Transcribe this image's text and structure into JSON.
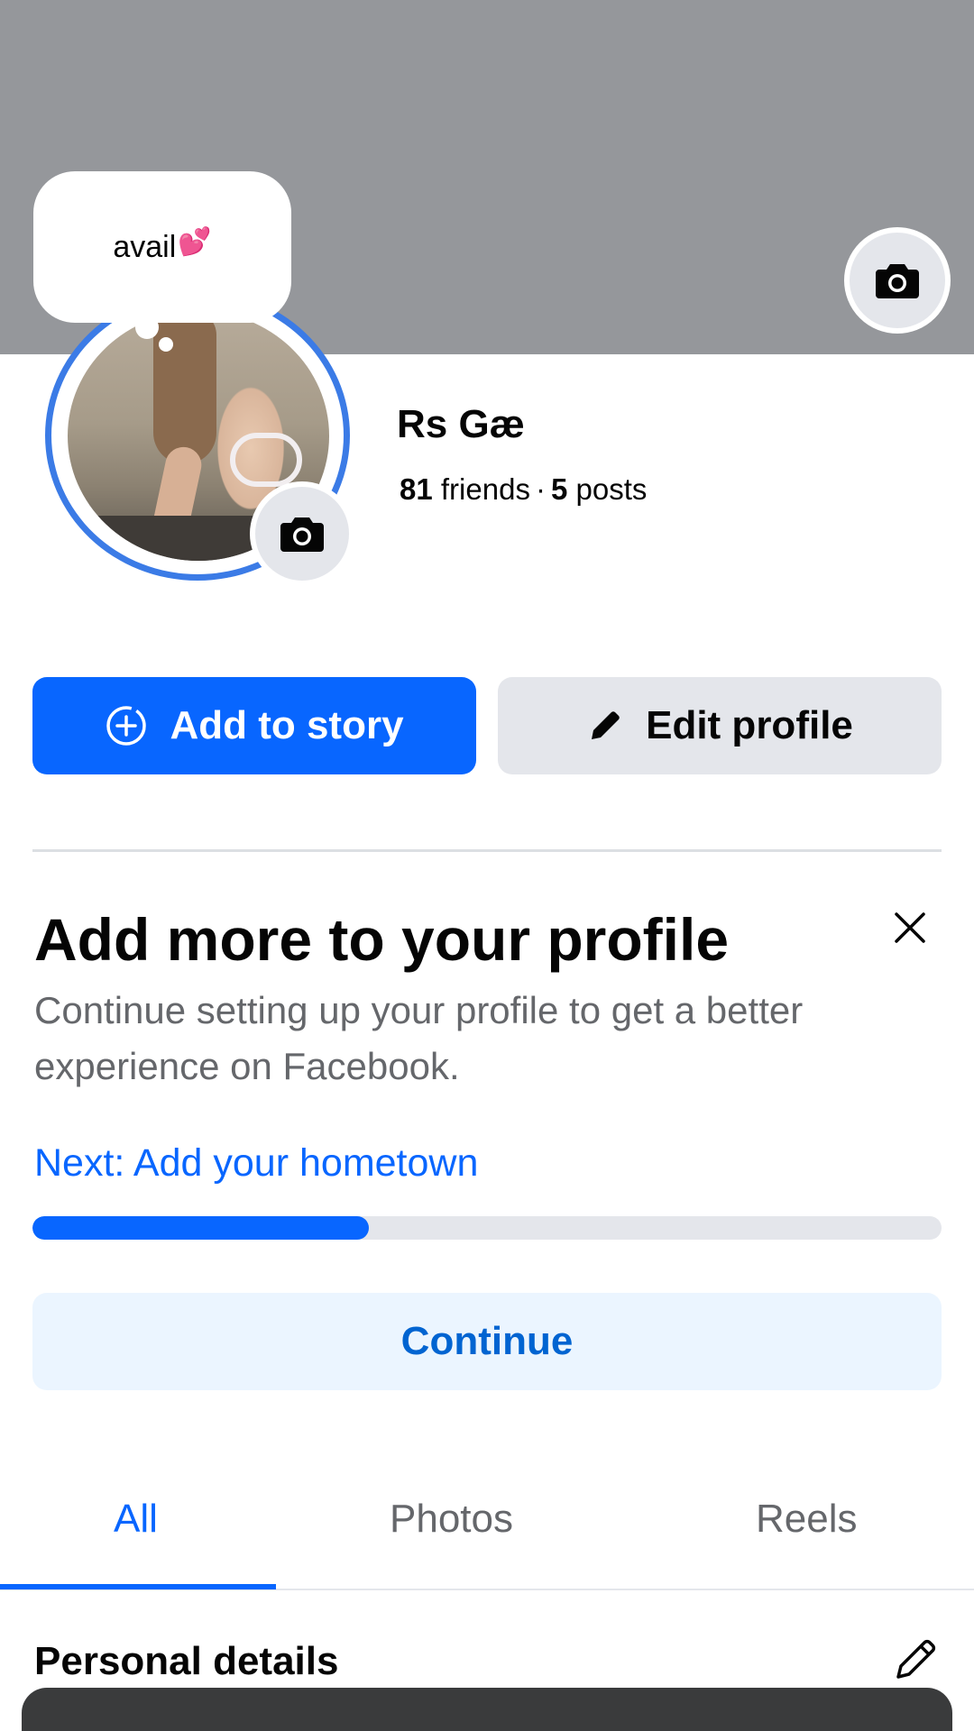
{
  "cover": {
    "camera_icon": "camera-icon"
  },
  "profile": {
    "note": "avail",
    "note_emoji": "💕",
    "name": "Rs Gæ",
    "friends_count": "81",
    "friends_label": "friends",
    "separator": "·",
    "posts_count": "5",
    "posts_label": "posts"
  },
  "actions": {
    "add_story_label": "Add to story",
    "edit_profile_label": "Edit profile"
  },
  "setup_card": {
    "title": "Add more to your profile",
    "description": "Continue setting up your profile to get a better experience on Facebook.",
    "next_step": "Next: Add your hometown",
    "progress": 0.37,
    "continue_label": "Continue"
  },
  "tabs": [
    {
      "label": "All",
      "active": true
    },
    {
      "label": "Photos",
      "active": false
    },
    {
      "label": "Reels",
      "active": false
    }
  ],
  "section": {
    "title": "Personal details"
  },
  "colors": {
    "primary": "#0866ff",
    "cover": "#95979b",
    "secondary_button": "#e4e6eb",
    "continue_bg": "#ebf5ff"
  }
}
